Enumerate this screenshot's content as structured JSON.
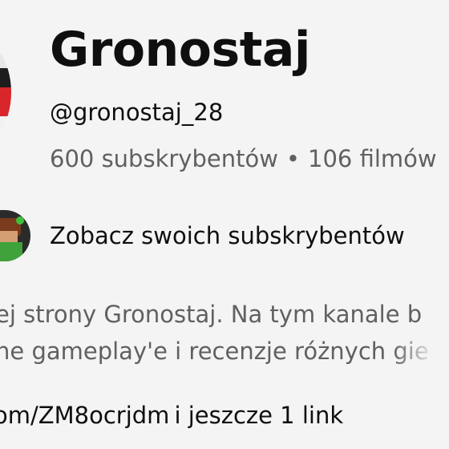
{
  "channel": {
    "name": "Gronostaj",
    "handle": "@gronostaj_28",
    "subscribers": "600 subskrybentów",
    "separator": "•",
    "videos": "106 filmów"
  },
  "subscribers_link": {
    "label": "Zobacz swoich subskrybentów"
  },
  "description": {
    "line1": "ej strony Gronostaj. Na tym kanale b",
    "line2": "ne gameplay'e i recenzje różnych gie"
  },
  "links": {
    "url": "om/ZM8ocrjdm",
    "more": "i jeszcze 1 link"
  },
  "colors": {
    "background": "#f4f4f4",
    "primary_text": "#0f0f0f",
    "secondary_text": "#606060"
  }
}
